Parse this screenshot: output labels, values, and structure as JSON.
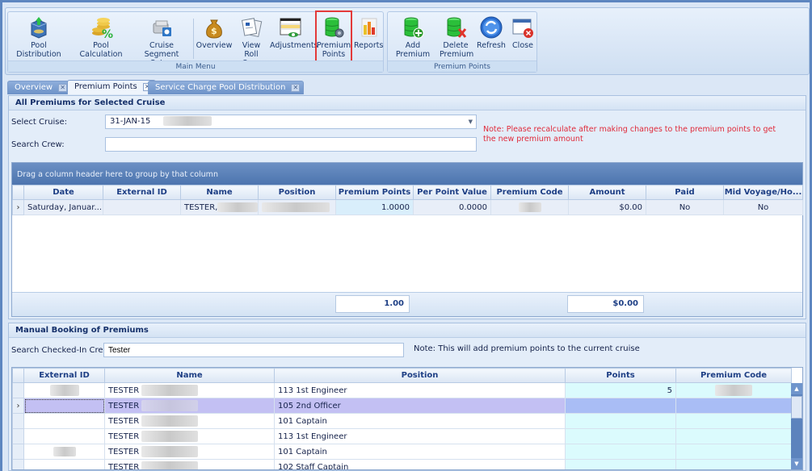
{
  "ribbon": {
    "main_group": {
      "label": "Main Menu",
      "buttons": [
        {
          "id": "pool-distribution",
          "label": "Pool Distribution",
          "icon": "pool-distribution-icon"
        },
        {
          "id": "pool-calculation",
          "label": "Pool Calculation",
          "icon": "coins-percent-icon"
        },
        {
          "id": "cruise-segment-setup",
          "label": "Cruise Segment Setup",
          "icon": "cruise-segment-icon"
        },
        {
          "id": "overview",
          "label": "Overview",
          "icon": "money-bag-icon"
        },
        {
          "id": "view-roll-over",
          "label": "View Roll Over",
          "icon": "documents-icon"
        },
        {
          "id": "adjustments",
          "label": "Adjustments",
          "icon": "calendar-adjust-icon"
        },
        {
          "id": "premium-points",
          "label": "Premium Points",
          "icon": "database-gear-icon",
          "selected": true
        },
        {
          "id": "reports",
          "label": "Reports",
          "icon": "bar-chart-icon"
        }
      ]
    },
    "premium_group": {
      "label": "Premium Points",
      "buttons": [
        {
          "id": "add-premium",
          "label": "Add Premium",
          "icon": "database-add-icon"
        },
        {
          "id": "delete-premium",
          "label": "Delete Premium",
          "icon": "database-delete-icon"
        },
        {
          "id": "refresh",
          "label": "Refresh",
          "icon": "refresh-icon"
        },
        {
          "id": "close",
          "label": "Close",
          "icon": "close-window-icon"
        }
      ]
    }
  },
  "tabs": [
    {
      "label": "Overview",
      "active": false
    },
    {
      "label": "Premium Points",
      "active": true
    },
    {
      "label": "Service Charge Pool Distribution",
      "active": false
    }
  ],
  "all_premiums": {
    "title": "All Premiums for Selected Cruise",
    "select_cruise_label": "Select Cruise:",
    "select_cruise_value": "31-JAN-15",
    "search_crew_label": "Search Crew:",
    "search_crew_value": "",
    "note": "Note: Please recalculate after making changes to the premium points to get the new premium amount",
    "group_hint": "Drag a column header here to group by that column",
    "columns": [
      "Date",
      "External ID",
      "Name",
      "Position",
      "Premium Points",
      "Per Point Value",
      "Premium Code",
      "Amount",
      "Paid",
      "Mid Voyage/Ho..."
    ],
    "rows": [
      {
        "date": "Saturday, Januar...",
        "external_id": "",
        "name": "TESTER,",
        "position": "",
        "premium_points": "1.0000",
        "per_point_value": "0.0000",
        "premium_code": "",
        "amount": "$0.00",
        "paid": "No",
        "mid_voyage": "No"
      }
    ],
    "totals": {
      "premium_points": "1.00",
      "amount": "$0.00"
    }
  },
  "manual_booking": {
    "title": "Manual Booking of Premiums",
    "search_label": "Search Checked-In Crew:",
    "search_value": "Tester",
    "note": "Note: This will add premium points to the current cruise",
    "columns": [
      "External ID",
      "Name",
      "Position",
      "Points",
      "Premium Code"
    ],
    "rows": [
      {
        "name": "TESTER",
        "position": "113 1st Engineer",
        "points": "5",
        "selected": false
      },
      {
        "name": "TESTER",
        "position": "105 2nd Officer",
        "points": "",
        "selected": true
      },
      {
        "name": "TESTER",
        "position": "101 Captain",
        "points": "",
        "selected": false
      },
      {
        "name": "TESTER",
        "position": "113 1st Engineer",
        "points": "",
        "selected": false
      },
      {
        "name": "TESTER",
        "position": "101 Captain",
        "points": "",
        "selected": false
      },
      {
        "name": "TESTER",
        "position": "102 Staff Captain",
        "points": "",
        "selected": false
      }
    ]
  },
  "colors": {
    "accent": "#4c74ae",
    "note_red": "#e02a3a",
    "selected_row": "#c3c0f3",
    "points_column": "#dbfbfd",
    "highlight_box": "#e33a3a"
  }
}
